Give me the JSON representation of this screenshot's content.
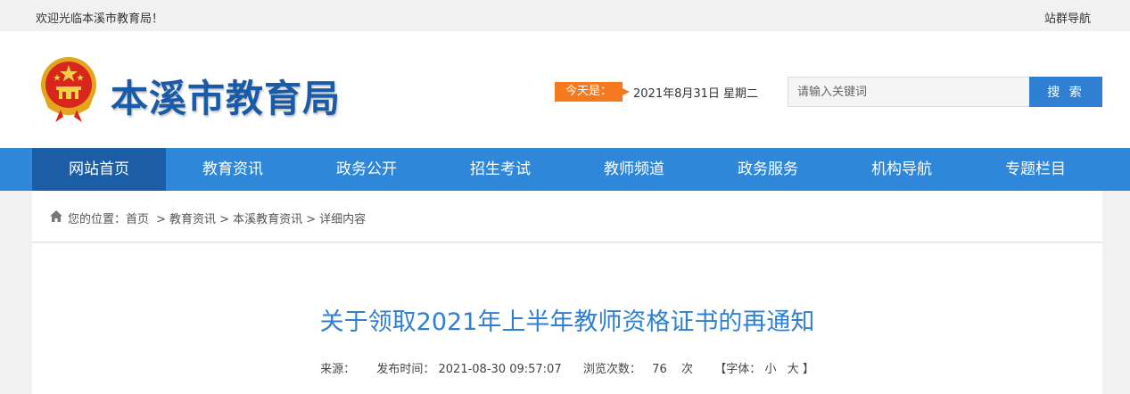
{
  "topbar": {
    "welcome": "欢迎光临本溪市教育局！",
    "site_nav": "站群导航"
  },
  "header": {
    "emblem_icon": "national-emblem-icon",
    "site_title": "本溪市教育局",
    "today_label": "今天是：",
    "today_date": "2021年8月31日 星期二",
    "search_placeholder": "请输入关键词",
    "search_button": "搜 索"
  },
  "nav": {
    "items": [
      {
        "label": "网站首页",
        "active": true
      },
      {
        "label": "教育资讯"
      },
      {
        "label": "政务公开"
      },
      {
        "label": "招生考试"
      },
      {
        "label": "教师频道"
      },
      {
        "label": "政务服务"
      },
      {
        "label": "机构导航"
      },
      {
        "label": "专题栏目"
      }
    ]
  },
  "breadcrumb": {
    "home_icon": "home-icon",
    "prefix": "您的位置：",
    "items": [
      "首页",
      "> 教育资讯",
      "> 本溪教育资讯",
      "> 详细内容"
    ]
  },
  "article": {
    "title": "关于领取2021年上半年教师资格证书的再通知",
    "source_label": "来源：",
    "publish_label": "发布时间：",
    "publish_time": "2021-08-30 09:57:07",
    "views_label": "浏览次数：",
    "views": "76",
    "views_unit": "次",
    "font_label": "【字体：",
    "font_small": "小",
    "font_large": "大",
    "font_close": "】"
  },
  "colors": {
    "brand_blue": "#1a5ba8",
    "nav_blue": "#2f87d9",
    "nav_active": "#1c5ea6",
    "accent_orange": "#f57a1f",
    "title_blue": "#2f7fd2"
  }
}
